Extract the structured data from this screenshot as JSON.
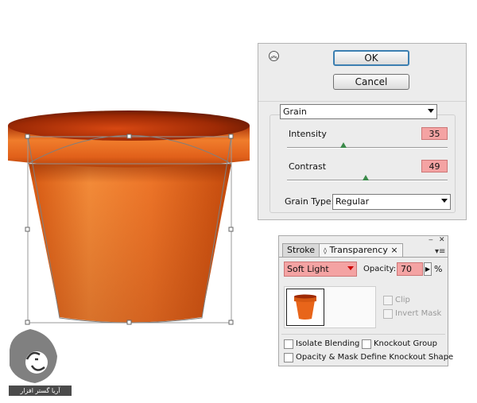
{
  "grain_dialog": {
    "ok_label": "OK",
    "cancel_label": "Cancel",
    "filter_selected": "Grain",
    "intensity_label": "Intensity",
    "intensity_value": "35",
    "contrast_label": "Contrast",
    "contrast_value": "49",
    "grain_type_label": "Grain Type:",
    "grain_type_selected": "Regular",
    "collapse_icon": "chevron-double-up-icon"
  },
  "transparency_panel": {
    "tabs": [
      {
        "label": "Stroke"
      },
      {
        "label": "Transparency",
        "icon": "diamond-arrows-icon"
      }
    ],
    "close_glyph": "×",
    "blend_mode": "Soft Light",
    "opacity_label": "Opacity:",
    "opacity_value": "70",
    "percent_sign": "%",
    "clip_label": "Clip",
    "invert_mask_label": "Invert Mask",
    "isolate_blending_label": "Isolate Blending",
    "knockout_group_label": "Knockout Group",
    "define_knockout_label": "Opacity & Mask Define Knockout Shape"
  },
  "watermark": {
    "text": "آریا گستر افزار"
  },
  "colors": {
    "highlight": "#f4a3a3",
    "pot_orange": "#e8651a",
    "pot_dark": "#b33a08",
    "dialog_bg": "#ececec"
  }
}
